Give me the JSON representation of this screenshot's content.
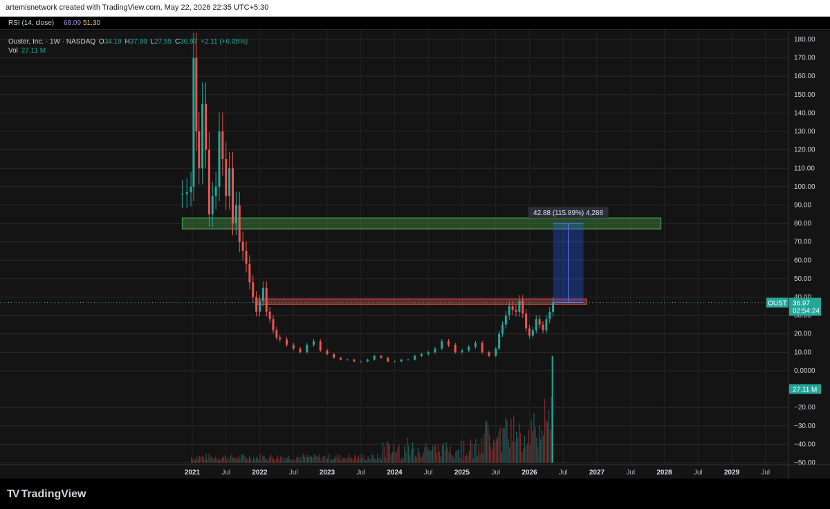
{
  "header": {
    "text": "artemisnetwork created with TradingView.com, May 22, 2026 22:35 UTC+5:30"
  },
  "rsi": {
    "label": "RSI (14, close)",
    "v1": "68.09",
    "v2": "51.30"
  },
  "legend": {
    "title": "Ouster, Inc. · 1W · NASDAQ",
    "o_label": "O",
    "o": "34.19",
    "h_label": "H",
    "h": "37.99",
    "l_label": "L",
    "l": "27.55",
    "c_label": "C",
    "c": "36.97",
    "change": "+2.11 (+6.05%)",
    "vol_label": "Vol",
    "vol": "27.11 M"
  },
  "measure_label": "42.88 (115.89%) 4,288",
  "price_tag": {
    "symbol": "OUST",
    "price": "36.97",
    "countdown": "02:54:24"
  },
  "vol_tag": "27.11 M",
  "logo": {
    "mark": "TV",
    "text": "TradingView"
  },
  "colors": {
    "up": "#26a69a",
    "down": "#ef5350",
    "volume": "#7b2a2a",
    "green_zone": "#4caf50",
    "red_zone": "#e5534b",
    "measure": "#2962ff"
  },
  "chart_data": {
    "type": "candlestick",
    "symbol": "OUST",
    "timeframe": "1W",
    "x_ticks": [
      "2021",
      "Jul",
      "2022",
      "Jul",
      "2023",
      "Jul",
      "2024",
      "Jul",
      "2025",
      "Jul",
      "2026",
      "Jul",
      "2027",
      "Jul",
      "2028",
      "Jul",
      "2029",
      "Jul"
    ],
    "y_ticks": [
      "180.00",
      "170.00",
      "160.00",
      "150.00",
      "140.00",
      "130.00",
      "120.00",
      "110.00",
      "100.00",
      "90.00",
      "80.00",
      "70.00",
      "60.00",
      "50.00",
      "40.00",
      "30.00",
      "20.00",
      "10.00",
      "0.0000",
      "−20.00",
      "−30.00",
      "−40.00",
      "−50.00"
    ],
    "ylim": [
      -50,
      180
    ],
    "price_series": {
      "dates": [
        2020.85,
        2020.92,
        2020.98,
        2021.02,
        2021.06,
        2021.1,
        2021.15,
        2021.2,
        2021.25,
        2021.3,
        2021.35,
        2021.4,
        2021.45,
        2021.5,
        2021.55,
        2021.6,
        2021.65,
        2021.7,
        2021.75,
        2021.8,
        2021.85,
        2021.9,
        2021.95,
        2022.0,
        2022.05,
        2022.1,
        2022.15,
        2022.2,
        2022.25,
        2022.3,
        2022.4,
        2022.5,
        2022.6,
        2022.7,
        2022.8,
        2022.9,
        2023.0,
        2023.1,
        2023.2,
        2023.3,
        2023.4,
        2023.5,
        2023.6,
        2023.7,
        2023.8,
        2023.9,
        2024.0,
        2024.1,
        2024.2,
        2024.3,
        2024.4,
        2024.5,
        2024.6,
        2024.7,
        2024.8,
        2024.9,
        2025.0,
        2025.1,
        2025.2,
        2025.3,
        2025.4,
        2025.5,
        2025.55,
        2025.6,
        2025.65,
        2025.7,
        2025.75,
        2025.8,
        2025.85,
        2025.9,
        2025.95,
        2026.0,
        2026.05,
        2026.1,
        2026.15,
        2026.2,
        2026.25,
        2026.3,
        2026.35
      ],
      "close": [
        96,
        97,
        100,
        170,
        130,
        110,
        145,
        120,
        85,
        95,
        100,
        130,
        115,
        95,
        110,
        80,
        90,
        70,
        65,
        58,
        48,
        40,
        32,
        38,
        45,
        32,
        28,
        22,
        18,
        17,
        14,
        12,
        10,
        14,
        16,
        11,
        9,
        7,
        6,
        6,
        5,
        5,
        6,
        8,
        7,
        5,
        5,
        6,
        6,
        8,
        9,
        10,
        12,
        16,
        14,
        10,
        11,
        13,
        15,
        10,
        8,
        12,
        20,
        25,
        30,
        35,
        33,
        32,
        38,
        31,
        23,
        19,
        22,
        28,
        25,
        22,
        28,
        32,
        37
      ]
    },
    "zones": [
      {
        "name": "resistance-80",
        "y0": 77,
        "y1": 83,
        "x0": 2020.85,
        "x1": 2027.95,
        "color": "#4caf50"
      },
      {
        "name": "resistance-37",
        "y0": 36,
        "y1": 39,
        "x0": 2021.95,
        "x1": 2026.85,
        "color": "#e5534b"
      }
    ],
    "measure": {
      "from_y": 37,
      "to_y": 80,
      "x0": 2026.35,
      "x1": 2026.8,
      "change": 42.88,
      "pct": 115.89,
      "ticks": 4288
    },
    "volume_peak": 27.11
  }
}
